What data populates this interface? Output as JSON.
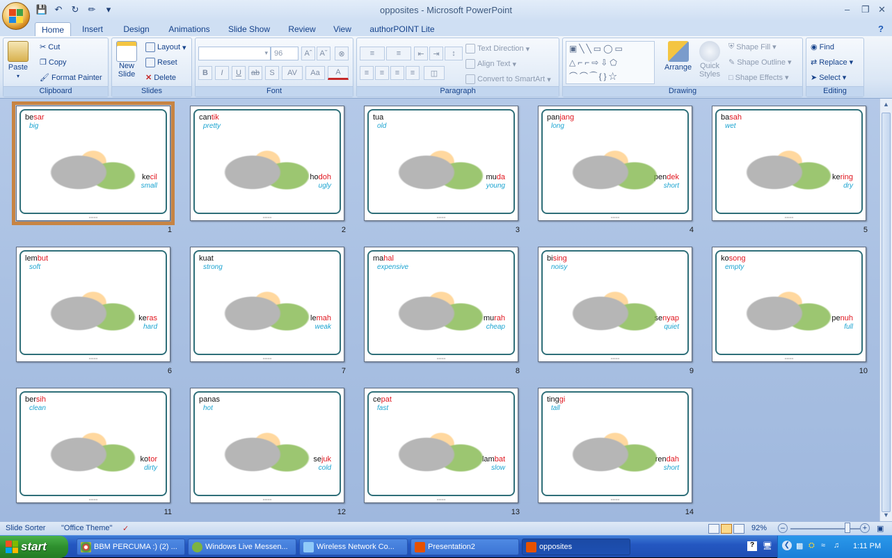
{
  "window": {
    "title": "opposites - Microsoft PowerPoint"
  },
  "qat_icons": [
    "save-icon",
    "undo-icon",
    "redo-icon",
    "paint-icon",
    "customize-icon"
  ],
  "tabs": [
    "Home",
    "Insert",
    "Design",
    "Animations",
    "Slide Show",
    "Review",
    "View",
    "authorPOINT Lite"
  ],
  "ribbon": {
    "clipboard": {
      "caption": "Clipboard",
      "paste": "Paste",
      "cut": "Cut",
      "copy": "Copy",
      "format_painter": "Format Painter"
    },
    "slides": {
      "caption": "Slides",
      "new_slide": "New",
      "new_slide2": "Slide",
      "layout": "Layout",
      "reset": "Reset",
      "delete": "Delete"
    },
    "font": {
      "caption": "Font",
      "size": "96"
    },
    "paragraph": {
      "caption": "Paragraph",
      "text_direction": "Text Direction",
      "align_text": "Align Text",
      "convert": "Convert to SmartArt"
    },
    "drawing": {
      "caption": "Drawing",
      "arrange": "Arrange",
      "quick": "Quick",
      "styles": "Styles",
      "shape_fill": "Shape Fill",
      "shape_outline": "Shape Outline",
      "shape_effects": "Shape Effects"
    },
    "editing": {
      "caption": "Editing",
      "find": "Find",
      "replace": "Replace",
      "select": "Select"
    }
  },
  "slides": [
    {
      "num": "1",
      "w1": [
        "be",
        "sar"
      ],
      "t1": "big",
      "w2": [
        "ke",
        "cil"
      ],
      "t2": "small"
    },
    {
      "num": "2",
      "w1": [
        "can",
        "tik"
      ],
      "t1": "pretty",
      "w2": [
        "ho",
        "doh"
      ],
      "t2": "ugly"
    },
    {
      "num": "3",
      "w1": [
        "tua",
        ""
      ],
      "t1": "old",
      "w2": [
        "mu",
        "da"
      ],
      "t2": "young"
    },
    {
      "num": "4",
      "w1": [
        "pan",
        "jang"
      ],
      "t1": "long",
      "w2": [
        "pen",
        "dek"
      ],
      "t2": "short"
    },
    {
      "num": "5",
      "w1": [
        "ba",
        "sah"
      ],
      "t1": "wet",
      "w2": [
        "ke",
        "ring"
      ],
      "t2": "dry"
    },
    {
      "num": "6",
      "w1": [
        "lem",
        "but"
      ],
      "t1": "soft",
      "w2": [
        "ke",
        "ras"
      ],
      "t2": "hard"
    },
    {
      "num": "7",
      "w1": [
        "kuat",
        ""
      ],
      "t1": "strong",
      "w2": [
        "le",
        "mah"
      ],
      "t2": "weak"
    },
    {
      "num": "8",
      "w1": [
        "ma",
        "hal"
      ],
      "t1": "expensive",
      "w2": [
        "mu",
        "rah"
      ],
      "t2": "cheap"
    },
    {
      "num": "9",
      "w1": [
        "bi",
        "sing"
      ],
      "t1": "noisy",
      "w2": [
        "se",
        "nyap"
      ],
      "t2": "quiet"
    },
    {
      "num": "10",
      "w1": [
        "ko",
        "song"
      ],
      "t1": "empty",
      "w2": [
        "pe",
        "nuh"
      ],
      "t2": "full"
    },
    {
      "num": "11",
      "w1": [
        "ber",
        "sih"
      ],
      "t1": "clean",
      "w2": [
        "ko",
        "tor"
      ],
      "t2": "dirty"
    },
    {
      "num": "12",
      "w1": [
        "panas",
        ""
      ],
      "t1": "hot",
      "w2": [
        "se",
        "juk"
      ],
      "t2": "cold"
    },
    {
      "num": "13",
      "w1": [
        "ce",
        "pat"
      ],
      "t1": "fast",
      "w2": [
        "lam",
        "bat"
      ],
      "t2": "slow"
    },
    {
      "num": "14",
      "w1": [
        "ting",
        "gi"
      ],
      "t1": "tall",
      "w2": [
        "ren",
        "dah"
      ],
      "t2": "short"
    }
  ],
  "status": {
    "view": "Slide Sorter",
    "theme": "\"Office Theme\"",
    "zoom": "92%"
  },
  "taskbar": {
    "start": "start",
    "tasks": [
      "BBM PERCUMA :) (2) ...",
      "Windows Live Messen...",
      "Wireless Network Co...",
      "Presentation2",
      "opposites"
    ],
    "clock": "1:11 PM"
  },
  "colors": {
    "accent_red": "#e0161f",
    "accent_blue": "#1aa3d0",
    "selection": "#c78443"
  }
}
